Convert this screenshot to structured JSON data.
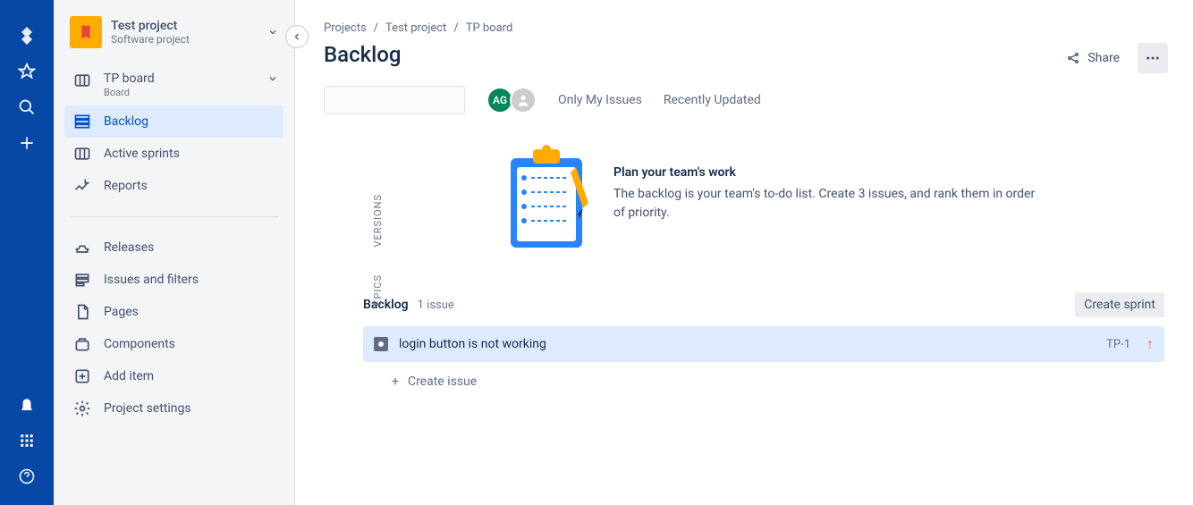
{
  "leftbar": {
    "logo_icon": "jira-icon",
    "star_icon": "star-icon",
    "search_icon": "search-icon",
    "plus_icon": "plus-icon",
    "notify_icon": "bell-icon",
    "apps_icon": "apps-icon",
    "help_icon": "help-icon"
  },
  "sidebar": {
    "project_name": "Test project",
    "project_type": "Software project",
    "board_name": "TP board",
    "board_sub": "Board",
    "nav": {
      "backlog": "Backlog",
      "active_sprints": "Active sprints",
      "reports": "Reports",
      "releases": "Releases",
      "issues_filters": "Issues and filters",
      "pages": "Pages",
      "components": "Components",
      "add_item": "Add item",
      "project_settings": "Project settings"
    }
  },
  "breadcrumb": {
    "root": "Projects",
    "project": "Test project",
    "board": "TP board",
    "sep": "/"
  },
  "page_title": "Backlog",
  "actions": {
    "share": "Share"
  },
  "avatar_initials": "AG",
  "quicklinks": {
    "only_my": "Only My Issues",
    "recently_updated": "Recently Updated"
  },
  "side_tabs": {
    "versions": "VERSIONS",
    "epics": "EPICS"
  },
  "onboarding": {
    "title": "Plan your team's work",
    "desc": "The backlog is your team's to-do list. Create 3 issues, and rank them in order of priority."
  },
  "backlog_section": {
    "title": "Backlog",
    "count": "1 issue",
    "create_sprint": "Create sprint"
  },
  "issue": {
    "title": "login button is not working",
    "key": "TP-1",
    "priority_glyph": "↑"
  },
  "create_issue": {
    "plus": "+",
    "label": "Create issue"
  }
}
